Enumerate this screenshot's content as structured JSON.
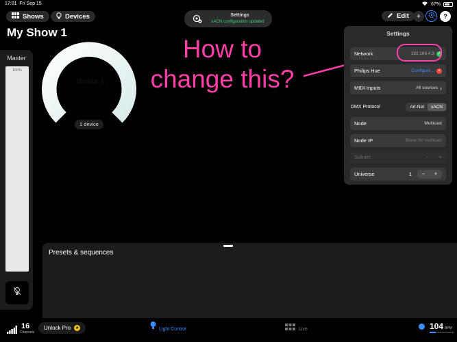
{
  "status_bar": {
    "time": "17:01",
    "date": "Fri Sep 15",
    "battery": "67%",
    "battery_level": 0.67
  },
  "top_bar": {
    "shows_label": "Shows",
    "devices_label": "Devices",
    "edit_label": "Edit",
    "add_icon": "plus-icon",
    "help_icon": "question-icon"
  },
  "toast": {
    "title": "Settings",
    "subtitle": "sACN configuration updated"
  },
  "page_title": "My Show 1",
  "master": {
    "label": "Master",
    "value": "100%"
  },
  "group": {
    "name": "Group 1",
    "devices": "1 device"
  },
  "annotation": {
    "line1": "How to",
    "line2": "change this?",
    "color": "#ff3fa8"
  },
  "settings": {
    "title": "Settings",
    "network": {
      "label": "Network",
      "value": "192.168.4.3",
      "status": "ok"
    },
    "philips_hue": {
      "label": "Philips Hue",
      "value": "Configure...",
      "status": "error"
    },
    "midi": {
      "label": "MIDI Inputs",
      "value": "All sources"
    },
    "dmx_protocol": {
      "label": "DMX Protocol",
      "options": [
        "Art-Net",
        "sACN"
      ],
      "selected": "sACN"
    },
    "node": {
      "label": "Node",
      "value": "Multicast"
    },
    "node_ip": {
      "label": "Node IP",
      "placeholder": "Blank for multicast"
    },
    "subnet": {
      "label": "Subnet",
      "minus": "-",
      "plus": "+"
    },
    "universe": {
      "label": "Universe",
      "value": "1",
      "minus": "−",
      "plus": "+"
    }
  },
  "presets": {
    "label": "Presets & sequences"
  },
  "bottom_bar": {
    "channels_count": "16",
    "channels_label": "Channels",
    "unlock_label": "Unlock Pro",
    "light_control_label": "Light Control",
    "live_label": "Live",
    "bpm_value": "104",
    "bpm_label": "BPM"
  },
  "colors": {
    "accent": "#3a8cff",
    "success": "#34c759",
    "error": "#ff453a",
    "highlight": "#ff3fa8"
  }
}
